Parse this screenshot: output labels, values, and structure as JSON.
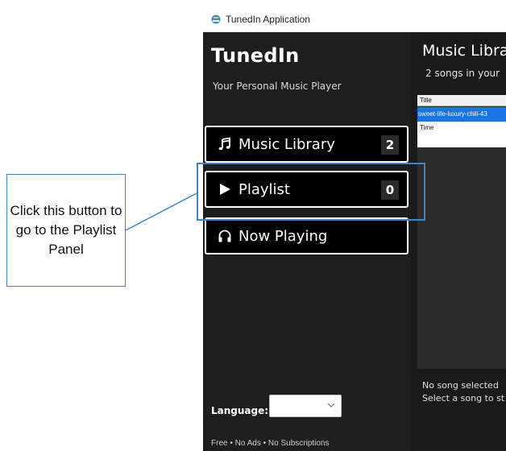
{
  "window": {
    "title": "TunedIn Application"
  },
  "sidebar": {
    "app_name": "TunedIn",
    "tagline": "Your Personal Music Player",
    "nav": [
      {
        "icon": "music-note-icon",
        "label": "Music Library",
        "count": "2"
      },
      {
        "icon": "play-icon",
        "label": "Playlist",
        "count": "0"
      },
      {
        "icon": "headphones-icon",
        "label": "Now Playing"
      }
    ],
    "language_label": "Language:",
    "language_selected": "",
    "footer": "Free • No Ads • No Subscriptions"
  },
  "main": {
    "title": "Music Libra",
    "subtitle": "2  songs in your",
    "column_header": "Title",
    "selected_row": "sweet-life-luxury-chill-43",
    "row_label": "Time",
    "status_line1": "No song selected",
    "status_line2": "Select a song to st"
  },
  "annotation": {
    "text": "Click this button to go to the Playlist Panel"
  },
  "colors": {
    "sidebar_bg": "#1e1e1e",
    "button_bg": "#000000",
    "selection_blue": "#1a73e8",
    "annotation_blue": "#3d85c6"
  }
}
